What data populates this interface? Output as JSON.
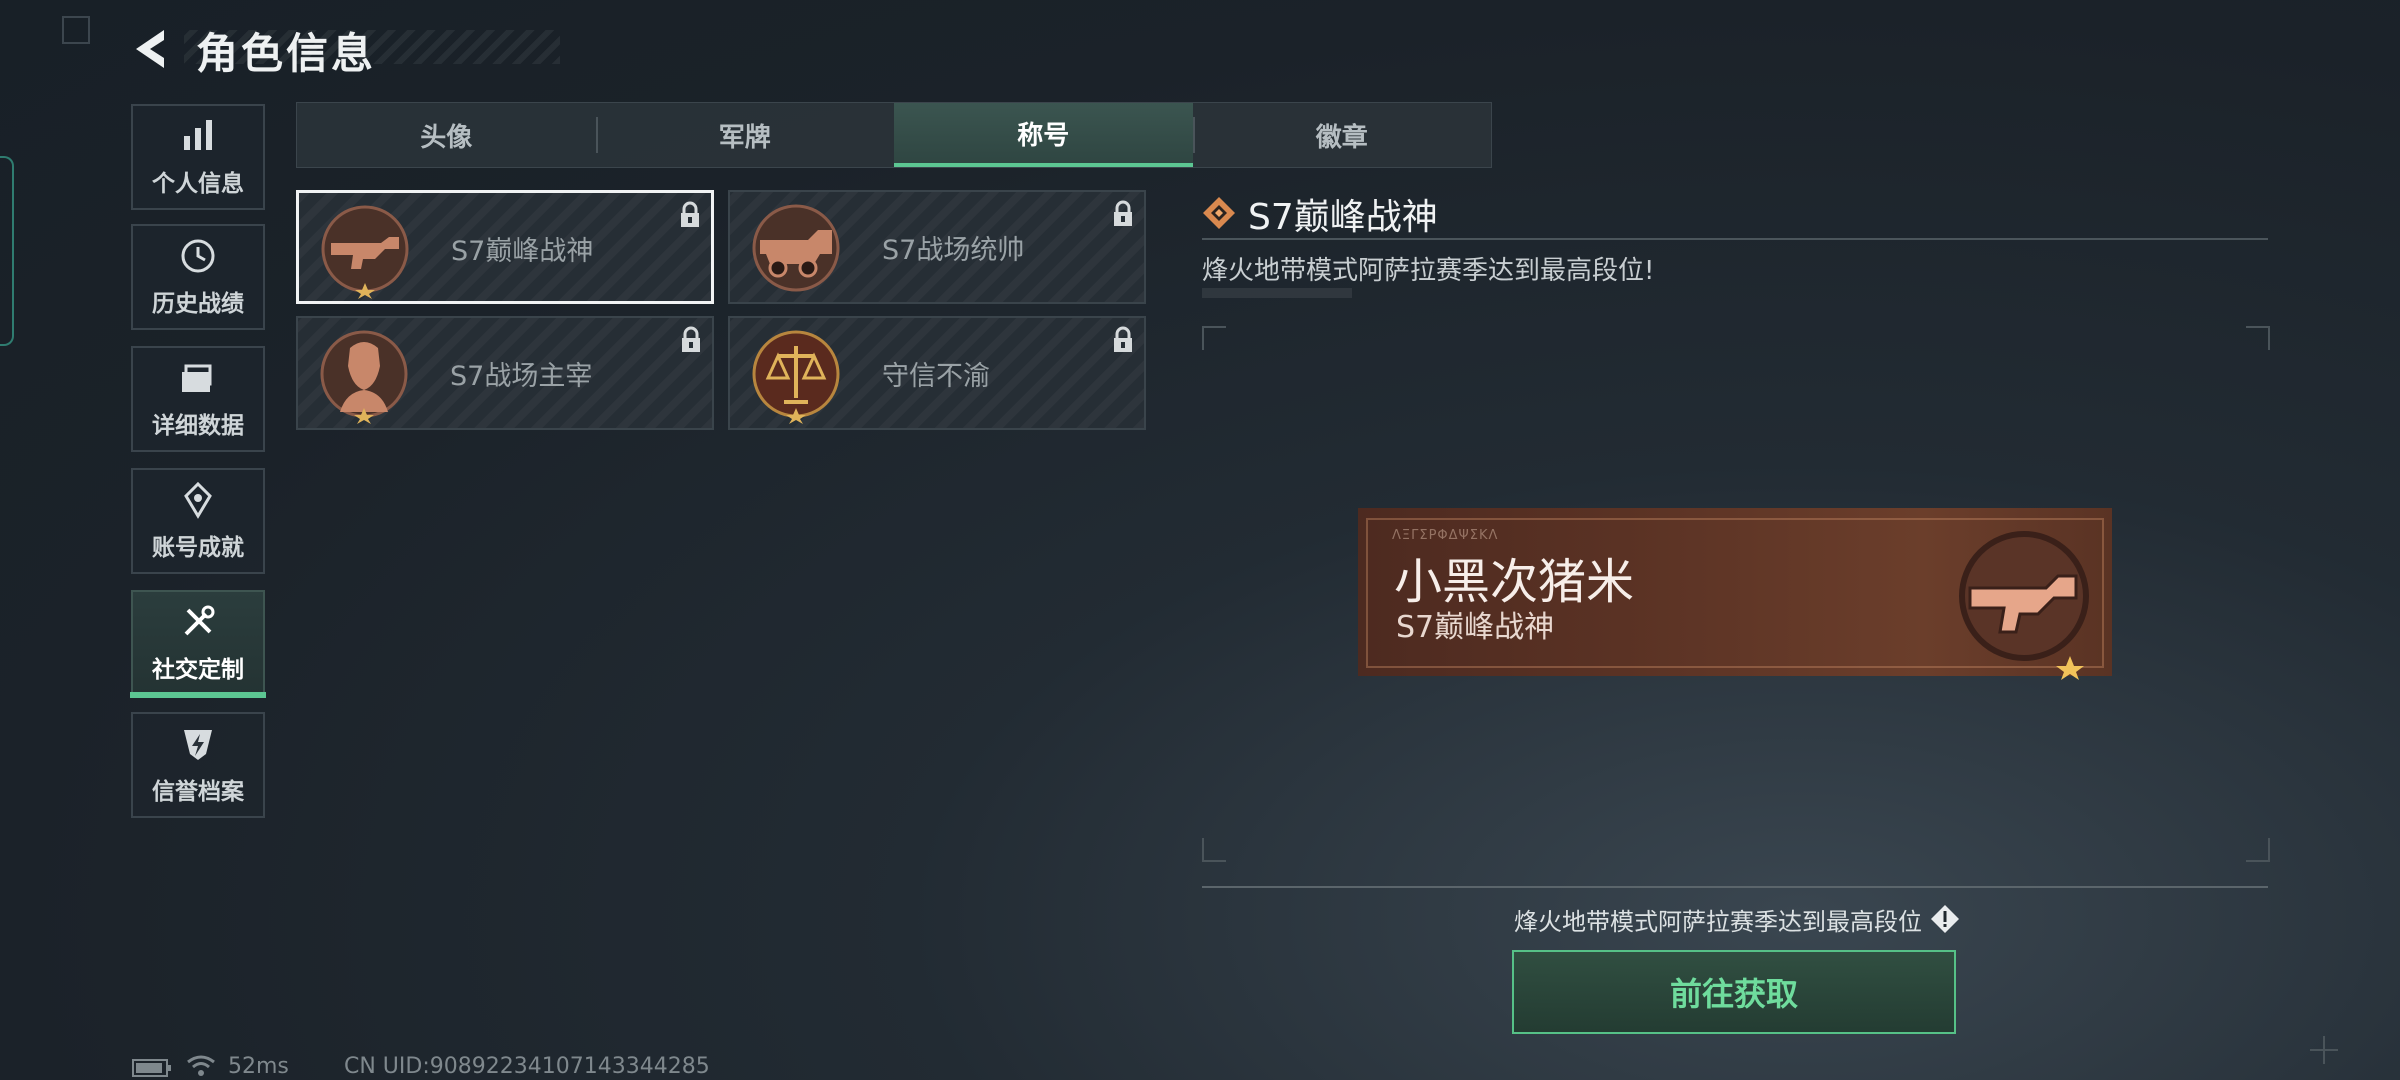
{
  "header": {
    "title": "角色信息"
  },
  "sidebar": {
    "items": [
      {
        "label": "个人信息",
        "icon": "bar-chart-icon"
      },
      {
        "label": "历史战绩",
        "icon": "clock-history-icon"
      },
      {
        "label": "详细数据",
        "icon": "folder-icon"
      },
      {
        "label": "账号成就",
        "icon": "achievement-icon"
      },
      {
        "label": "社交定制",
        "icon": "tools-icon",
        "active": true
      },
      {
        "label": "信誉档案",
        "icon": "shield-bolt-icon"
      }
    ]
  },
  "tabs": [
    {
      "label": "头像"
    },
    {
      "label": "军牌"
    },
    {
      "label": "称号",
      "active": true
    },
    {
      "label": "徽章"
    }
  ],
  "titles": [
    {
      "name": "S7巅峰战神",
      "locked": true,
      "selected": true,
      "emblem": "rifle-emblem-icon"
    },
    {
      "name": "S7战场统帅",
      "locked": true,
      "emblem": "vehicle-emblem-icon"
    },
    {
      "name": "S7战场主宰",
      "locked": true,
      "emblem": "soldier-emblem-icon"
    },
    {
      "name": "守信不渝",
      "locked": true,
      "emblem": "scales-emblem-icon"
    }
  ],
  "detail": {
    "title": "S7巅峰战神",
    "description": "烽火地带模式阿萨拉赛季达到最高段位!",
    "nameplate": {
      "player_name": "小黑次猪米",
      "title": "S7巅峰战神",
      "deco_text": "ΛΞΓΣΡΦΔΨΣΚΛ"
    },
    "requirement": "烽火地带模式阿萨拉赛季达到最高段位",
    "action_label": "前往获取"
  },
  "status": {
    "ping": "52ms",
    "uid": "CN UID:9089223410714334428​5"
  },
  "colors": {
    "accent_green": "#5cc692",
    "emblem_bronze": "#c8876a",
    "plate_brown": "#5a3224"
  }
}
